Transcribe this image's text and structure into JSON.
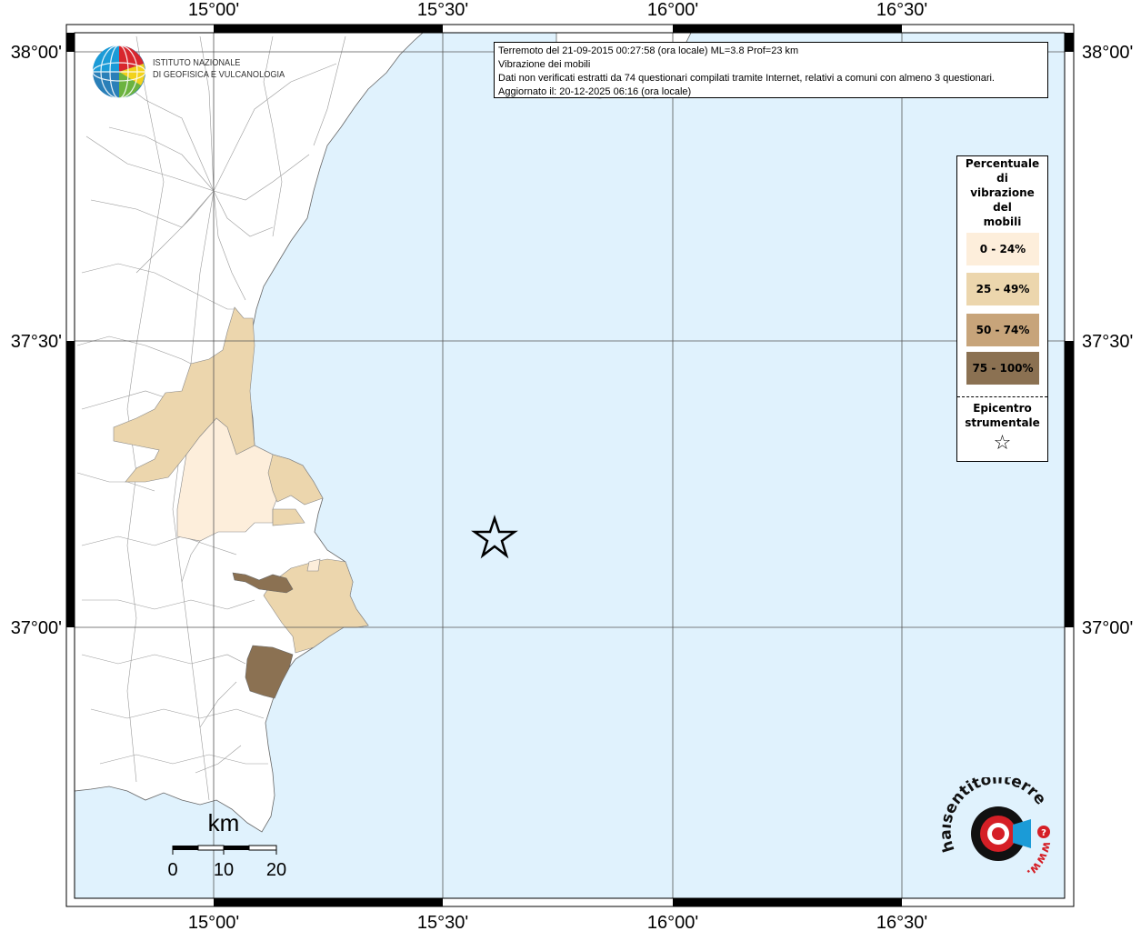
{
  "header": {
    "line1": "Terremoto del 21-09-2015 00:27:58 (ora locale) ML=3.8 Prof=23 km",
    "line2": "Vibrazione dei mobili",
    "line3": "Dati non verificati estratti da 74 questionari compilati tramite Internet, relativi a comuni con almeno 3 questionari.",
    "line4": "Aggiornato il: 20-12-2025 06:16 (ora locale)"
  },
  "axes": {
    "lon_labels": [
      "15°00'",
      "15°30'",
      "16°00'",
      "16°30'"
    ],
    "lat_labels": [
      "38°00'",
      "37°30'",
      "37°00'"
    ]
  },
  "legend": {
    "title_lines": [
      "Percentuale",
      "di",
      "vibrazione",
      "del",
      "mobili"
    ],
    "items": [
      {
        "label": "0 - 24%",
        "color": "#fdeedb"
      },
      {
        "label": "25 - 49%",
        "color": "#ecd6ad"
      },
      {
        "label": "50 - 74%",
        "color": "#c7a47a"
      },
      {
        "label": "75 - 100%",
        "color": "#8b7152"
      }
    ],
    "epicenter_lines": [
      "Epicentro",
      "strumentale"
    ],
    "epicenter_symbol": "☆"
  },
  "scale": {
    "unit": "km",
    "ticks": [
      "0",
      "10",
      "20"
    ]
  },
  "logos": {
    "ingv_line1": "ISTITUTO NAZIONALE",
    "ingv_line2": "DI GEOFISICA E VULCANOLOGIA",
    "hst_text": "haisentitoilterremoto.it",
    "hst_www": "www."
  },
  "colors": {
    "sea": "#e0f2fd",
    "land": "#ffffff",
    "class1": "#fdeedb",
    "class2": "#ecd6ad",
    "class3": "#c7a47a",
    "class4": "#8b7152"
  }
}
